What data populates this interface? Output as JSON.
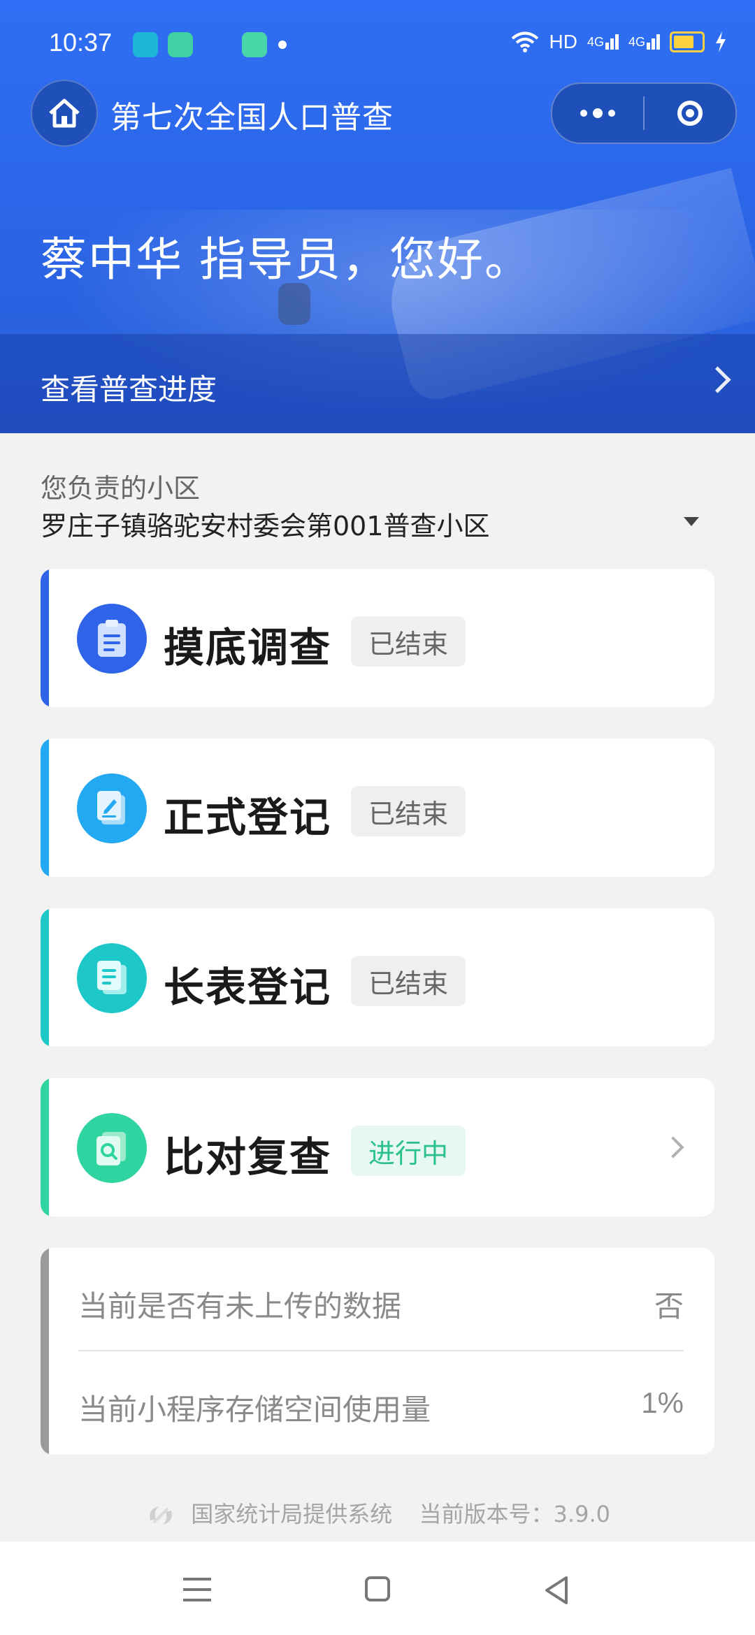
{
  "status_bar": {
    "time": "10:37",
    "right_text": "HD",
    "signal_1": "4G",
    "signal_2": "4G",
    "icons": [
      "k-app-icon",
      "green-app-icon",
      "teal-app-icon",
      "notification-dot",
      "wifi-icon",
      "signal-icon",
      "battery-icon",
      "charging-icon"
    ]
  },
  "header": {
    "title": "第七次全国人口普查",
    "greeting": "蔡中华 指导员，您好。",
    "progress_link": "查看普查进度"
  },
  "area": {
    "label": "您负责的小区",
    "value": "罗庄子镇骆驼安村委会第001普查小区"
  },
  "tasks": [
    {
      "title": "摸底调查",
      "status": "已结束",
      "accent": "#2f64e8"
    },
    {
      "title": "正式登记",
      "status": "已结束",
      "accent": "#23a9f2"
    },
    {
      "title": "长表登记",
      "status": "已结束",
      "accent": "#1fc8c8"
    },
    {
      "title": "比对复查",
      "status": "进行中",
      "accent": "#2fd4a0"
    }
  ],
  "info": {
    "unuploaded_label": "当前是否有未上传的数据",
    "unuploaded_value": "否",
    "storage_label": "当前小程序存储空间使用量",
    "storage_value": "1%"
  },
  "footer": {
    "provider": "国家统计局提供系统",
    "version": "当前版本号：3.9.0"
  },
  "colors": {
    "header_blue": "#2f6ef4",
    "active_green": "#2bc18a"
  }
}
